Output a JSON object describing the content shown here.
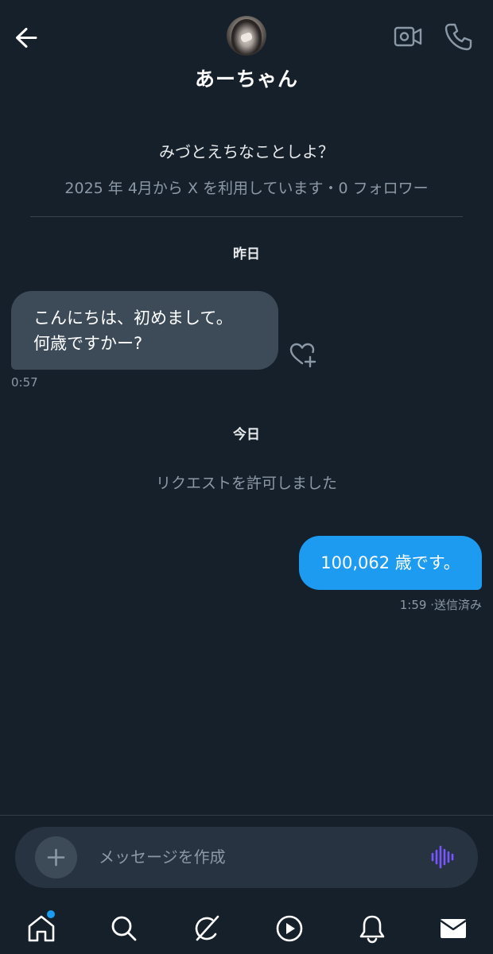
{
  "header": {
    "contact_name": "あーちゃん"
  },
  "profile": {
    "bio": "みづとえちなことしよ？",
    "joined_info": "2025 年 4月から X を利用しています・0 フォロワー"
  },
  "conversation": {
    "sections": [
      {
        "date_label": "昨日",
        "message": {
          "direction": "incoming",
          "lines": [
            "こんにちは、初めまして。",
            "何歳ですかー?"
          ],
          "time": "0:57"
        }
      },
      {
        "date_label": "今日",
        "system_message": "リクエストを許可しました",
        "message": {
          "direction": "outgoing",
          "text": "100,062 歳です。",
          "time": "1:59",
          "status": "·送信済み"
        }
      }
    ]
  },
  "composer": {
    "placeholder": "メッセージを作成"
  },
  "nav": {
    "items": [
      "home-icon",
      "search-icon",
      "grok-icon",
      "video-play-icon",
      "notifications-icon",
      "messages-icon"
    ],
    "home_has_badge": true
  },
  "colors": {
    "background": "#15202b",
    "incoming_bubble": "#3d4b59",
    "outgoing_bubble": "#1d9bf0",
    "secondary_text": "#8b98a5",
    "accent": "#1d9bf0",
    "voice_icon": "#7856ff"
  }
}
